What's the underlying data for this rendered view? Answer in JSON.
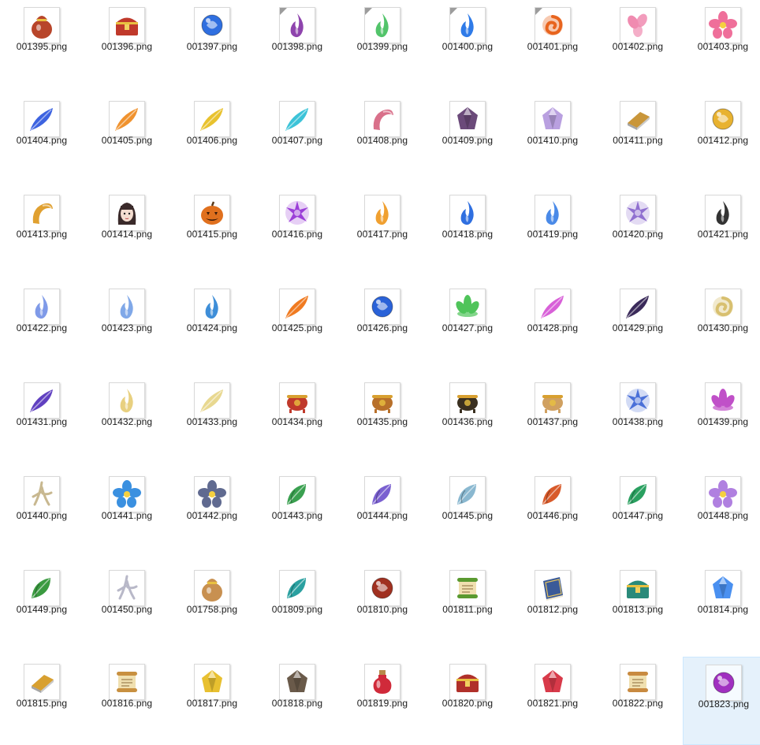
{
  "window": {
    "view": "file-list-large-icons"
  },
  "files": [
    {
      "name": "001395.png",
      "icon": "treasure-bag-icon",
      "color": "#b8452a",
      "shape": "bag"
    },
    {
      "name": "001396.png",
      "icon": "treasure-chest-icon",
      "color": "#c0392b",
      "shape": "chest"
    },
    {
      "name": "001397.png",
      "icon": "blue-flame-orb-icon",
      "color": "#2f6fe0",
      "shape": "orb"
    },
    {
      "name": "001398.png",
      "icon": "purple-flame-icon",
      "color": "#8e44ad",
      "shape": "flame",
      "tag": true
    },
    {
      "name": "001399.png",
      "icon": "green-flame-icon",
      "color": "#52c46a",
      "shape": "flame",
      "tag": true
    },
    {
      "name": "001400.png",
      "icon": "blue-flame-icon",
      "color": "#2f7be8",
      "shape": "flame",
      "tag": true
    },
    {
      "name": "001401.png",
      "icon": "fire-swirl-icon",
      "color": "#e8641e",
      "shape": "swirl",
      "tag": true
    },
    {
      "name": "001402.png",
      "icon": "pink-petals-icon",
      "color": "#f08bb0",
      "shape": "petals"
    },
    {
      "name": "001403.png",
      "icon": "pink-flower-icon",
      "color": "#ef6f9a",
      "shape": "flower"
    },
    {
      "name": "001404.png",
      "icon": "blue-feather-icon",
      "color": "#3d63e0",
      "shape": "feather"
    },
    {
      "name": "001405.png",
      "icon": "orange-feather-icon",
      "color": "#f0922e",
      "shape": "feather"
    },
    {
      "name": "001406.png",
      "icon": "gold-feather-icon",
      "color": "#e8c22e",
      "shape": "feather"
    },
    {
      "name": "001407.png",
      "icon": "cyan-feather-icon",
      "color": "#3cc3d8",
      "shape": "feather"
    },
    {
      "name": "001408.png",
      "icon": "pink-horn-icon",
      "color": "#d9708a",
      "shape": "horn"
    },
    {
      "name": "001409.png",
      "icon": "dark-crystal-icon",
      "color": "#6b4a7a",
      "shape": "gem"
    },
    {
      "name": "001410.png",
      "icon": "lilac-crystal-icon",
      "color": "#b9a0e0",
      "shape": "gem"
    },
    {
      "name": "001411.png",
      "icon": "gold-bar-icon",
      "color": "#c9963a",
      "shape": "bar"
    },
    {
      "name": "001412.png",
      "icon": "jeweled-scepter-icon",
      "color": "#e8b230",
      "shape": "orb"
    },
    {
      "name": "001413.png",
      "icon": "dragon-head-icon",
      "color": "#e0a030",
      "shape": "horn"
    },
    {
      "name": "001414.png",
      "icon": "girl-portrait-icon",
      "color": "#3a2a2a",
      "shape": "face"
    },
    {
      "name": "001415.png",
      "icon": "pumpkin-icon",
      "color": "#e0701e",
      "shape": "pumpkin"
    },
    {
      "name": "001416.png",
      "icon": "purple-burst-icon",
      "color": "#9b3fd8",
      "shape": "burst"
    },
    {
      "name": "001417.png",
      "icon": "orange-flame-icon",
      "color": "#f0a030",
      "shape": "flame"
    },
    {
      "name": "001418.png",
      "icon": "blue-wisp-icon",
      "color": "#2f6fe0",
      "shape": "flame"
    },
    {
      "name": "001419.png",
      "icon": "blue-bottle-flame-icon",
      "color": "#4a8ae8",
      "shape": "flame"
    },
    {
      "name": "001420.png",
      "icon": "violet-burst-icon",
      "color": "#9070d0",
      "shape": "burst"
    },
    {
      "name": "001421.png",
      "icon": "black-flame-icon",
      "color": "#333333",
      "shape": "flame"
    },
    {
      "name": "001422.png",
      "icon": "pale-blue-wisp-icon",
      "color": "#7f9ae8",
      "shape": "flame"
    },
    {
      "name": "001423.png",
      "icon": "light-blue-wisp-icon",
      "color": "#80a8e8",
      "shape": "flame"
    },
    {
      "name": "001424.png",
      "icon": "blue-fist-flame-icon",
      "color": "#3e8ed8",
      "shape": "flame"
    },
    {
      "name": "001425.png",
      "icon": "fire-feather-icon",
      "color": "#f07a20",
      "shape": "feather"
    },
    {
      "name": "001426.png",
      "icon": "blue-shield-flame-icon",
      "color": "#2a62d8",
      "shape": "orb"
    },
    {
      "name": "001427.png",
      "icon": "green-lotus-icon",
      "color": "#4fc45a",
      "shape": "lotus"
    },
    {
      "name": "001428.png",
      "icon": "pink-wing-icon",
      "color": "#d860d8",
      "shape": "feather"
    },
    {
      "name": "001429.png",
      "icon": "dark-wing-icon",
      "color": "#3a2a5a",
      "shape": "feather"
    },
    {
      "name": "001430.png",
      "icon": "gold-vortex-icon",
      "color": "#d8c070",
      "shape": "swirl"
    },
    {
      "name": "001431.png",
      "icon": "purple-feather-icon",
      "color": "#6040c0",
      "shape": "feather"
    },
    {
      "name": "001432.png",
      "icon": "pale-gold-wisp-icon",
      "color": "#e8d080",
      "shape": "flame"
    },
    {
      "name": "001433.png",
      "icon": "cream-wisp-icon",
      "color": "#e8d890",
      "shape": "feather"
    },
    {
      "name": "001434.png",
      "icon": "red-cauldron-icon",
      "color": "#c0392b",
      "shape": "cauldron"
    },
    {
      "name": "001435.png",
      "icon": "ornate-cauldron-icon",
      "color": "#b8702a",
      "shape": "cauldron"
    },
    {
      "name": "001436.png",
      "icon": "black-cauldron-icon",
      "color": "#3a3020",
      "shape": "cauldron"
    },
    {
      "name": "001437.png",
      "icon": "bronze-cauldron-icon",
      "color": "#d0a060",
      "shape": "cauldron"
    },
    {
      "name": "001438.png",
      "icon": "blue-star-flower-icon",
      "color": "#4a70d8",
      "shape": "burst"
    },
    {
      "name": "001439.png",
      "icon": "magenta-lotus-icon",
      "color": "#c050c8",
      "shape": "lotus"
    },
    {
      "name": "001440.png",
      "icon": "ginseng-root-icon",
      "color": "#c8b890",
      "shape": "root"
    },
    {
      "name": "001441.png",
      "icon": "blue-lily-icon",
      "color": "#3a90e0",
      "shape": "flower"
    },
    {
      "name": "001442.png",
      "icon": "grey-blossom-icon",
      "color": "#606a90",
      "shape": "flower"
    },
    {
      "name": "001443.png",
      "icon": "green-herb-icon",
      "color": "#3aa050",
      "shape": "leaf"
    },
    {
      "name": "001444.png",
      "icon": "purple-herb-icon",
      "color": "#7a60d0",
      "shape": "leaf"
    },
    {
      "name": "001445.png",
      "icon": "pale-herb-icon",
      "color": "#8ab8d0",
      "shape": "leaf"
    },
    {
      "name": "001446.png",
      "icon": "red-leaves-icon",
      "color": "#d85a2a",
      "shape": "leaf"
    },
    {
      "name": "001447.png",
      "icon": "green-clover-icon",
      "color": "#2aa060",
      "shape": "leaf"
    },
    {
      "name": "001448.png",
      "icon": "lavender-flower-icon",
      "color": "#b080e0",
      "shape": "flower"
    },
    {
      "name": "001449.png",
      "icon": "green-leaf-icon",
      "color": "#3a9a40",
      "shape": "leaf"
    },
    {
      "name": "001450.png",
      "icon": "white-twig-icon",
      "color": "#b8b8c8",
      "shape": "root"
    },
    {
      "name": "001758.png",
      "icon": "coin-pouch-icon",
      "color": "#c89050",
      "shape": "bag"
    },
    {
      "name": "001809.png",
      "icon": "teal-sprout-icon",
      "color": "#2aa0a0",
      "shape": "leaf"
    },
    {
      "name": "001810.png",
      "icon": "lava-orb-icon",
      "color": "#a03020",
      "shape": "orb"
    },
    {
      "name": "001811.png",
      "icon": "green-scroll-icon",
      "color": "#5a9a30",
      "shape": "scroll"
    },
    {
      "name": "001812.png",
      "icon": "blue-book-icon",
      "color": "#3a5a98",
      "shape": "book"
    },
    {
      "name": "001813.png",
      "icon": "jade-heart-box-icon",
      "color": "#2a8a7a",
      "shape": "chest"
    },
    {
      "name": "001814.png",
      "icon": "blue-shards-icon",
      "color": "#4a90f0",
      "shape": "gem"
    },
    {
      "name": "001815.png",
      "icon": "gold-ingots-icon",
      "color": "#d8a030",
      "shape": "bar"
    },
    {
      "name": "001816.png",
      "icon": "bamboo-scroll-icon",
      "color": "#c89040",
      "shape": "scroll"
    },
    {
      "name": "001817.png",
      "icon": "gold-ore-icon",
      "color": "#e8c030",
      "shape": "gem"
    },
    {
      "name": "001818.png",
      "icon": "rock-ore-icon",
      "color": "#6a5a4a",
      "shape": "gem"
    },
    {
      "name": "001819.png",
      "icon": "red-potion-icon",
      "color": "#d02a3a",
      "shape": "potion"
    },
    {
      "name": "001820.png",
      "icon": "red-gold-chest-icon",
      "color": "#b0302a",
      "shape": "chest"
    },
    {
      "name": "001821.png",
      "icon": "red-crystal-icon",
      "color": "#d83a4a",
      "shape": "gem"
    },
    {
      "name": "001822.png",
      "icon": "leather-scroll-icon",
      "color": "#c88a40",
      "shape": "scroll"
    },
    {
      "name": "001823.png",
      "icon": "purple-orb-icon",
      "color": "#a030c0",
      "shape": "orb",
      "selected": true
    }
  ]
}
